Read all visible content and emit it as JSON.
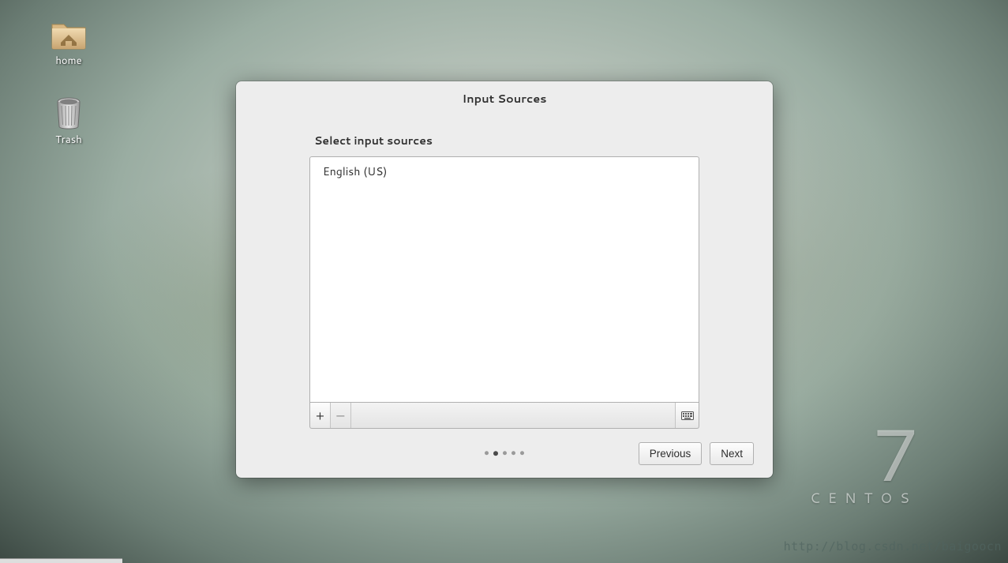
{
  "desktop": {
    "icons": {
      "home_label": "home",
      "trash_label": "Trash"
    },
    "branding": {
      "version": "7",
      "distro": "CENTOS"
    },
    "watermark": "http://blog.csdn.net/baigoocn"
  },
  "dialog": {
    "title": "Input Sources",
    "section_label": "Select input sources",
    "sources": [
      {
        "label": "English (US)"
      }
    ],
    "toolbar": {
      "add_glyph": "+",
      "remove_glyph": "−"
    },
    "pager": {
      "total": 5,
      "active_index": 1
    },
    "buttons": {
      "previous": "Previous",
      "next": "Next"
    }
  }
}
